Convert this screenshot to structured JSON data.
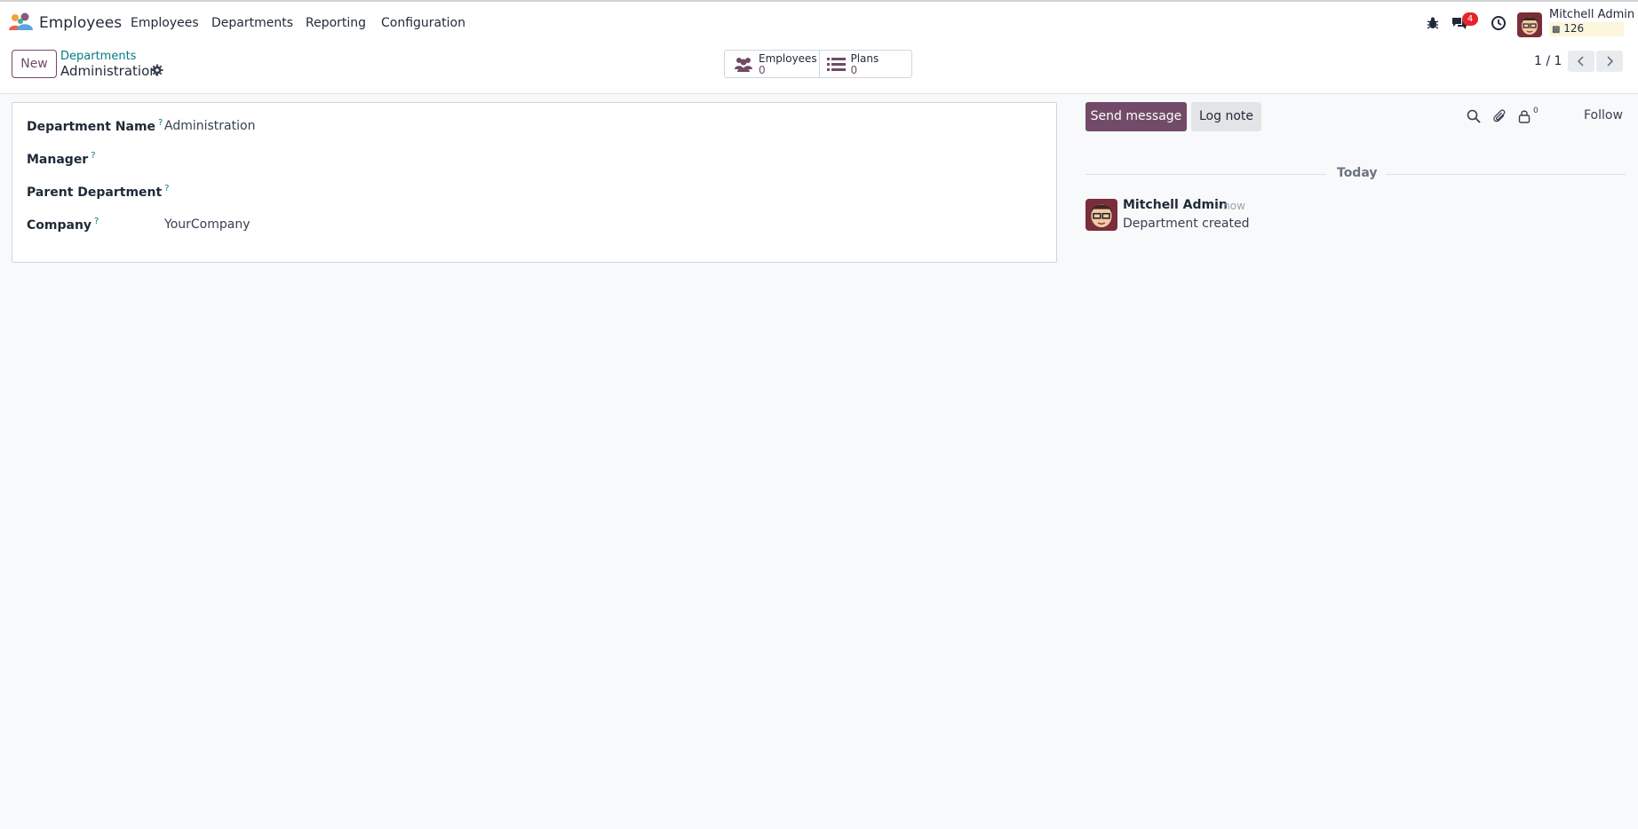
{
  "nav": {
    "app_title": "Employees",
    "menu": [
      "Employees",
      "Departments",
      "Reporting",
      "Configuration"
    ],
    "messages_badge": "4",
    "user_name": "Mitchell Admin",
    "user_db": "126"
  },
  "control": {
    "new_label": "New",
    "breadcrumb_parent": "Departments",
    "breadcrumb_current": "Administration",
    "smart_buttons": [
      {
        "label": "Employees",
        "value": "0",
        "icon": "users-icon"
      },
      {
        "label": "Plans",
        "value": "0",
        "icon": "list-icon"
      }
    ],
    "pager": "1 / 1"
  },
  "form": {
    "fields": [
      {
        "label": "Department Name",
        "help": "?",
        "value": "Administration"
      },
      {
        "label": "Manager",
        "help": "?",
        "value": ""
      },
      {
        "label": "Parent Department",
        "help": "?",
        "value": ""
      },
      {
        "label": "Company",
        "help": "?",
        "value": "YourCompany"
      }
    ]
  },
  "chatter": {
    "send_label": "Send message",
    "log_label": "Log note",
    "follower_count": "0",
    "follow_label": "Follow",
    "date_separator": "Today",
    "message": {
      "author": "Mitchell Admin",
      "time": "- now",
      "body": "Department created"
    }
  },
  "colors": {
    "brand": "#714b67",
    "link": "#017e84",
    "badge": "#e4242c"
  }
}
